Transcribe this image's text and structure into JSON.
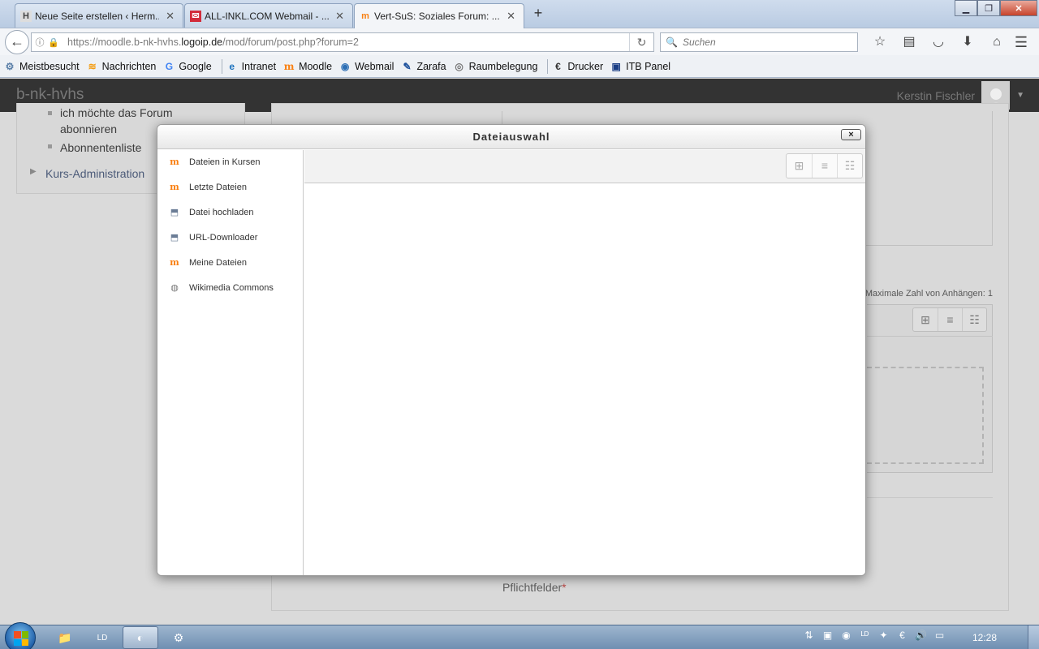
{
  "browser": {
    "tabs": [
      {
        "title": "Neue Seite erstellen ‹ Herm...",
        "icon": "hermes-icon",
        "glyph": "H",
        "color": "#444444"
      },
      {
        "title": "ALL-INKL.COM Webmail - ...",
        "icon": "allinkl-icon",
        "glyph": "✉",
        "color": "#d22c3b"
      },
      {
        "title": "Vert-SuS: Soziales Forum: ...",
        "icon": "moodle-icon",
        "glyph": "m",
        "color": "#f98012"
      }
    ],
    "url_prefix": "https://moodle.b-nk-hvhs.",
    "url_domain": "logoip.de",
    "url_path": "/mod/forum/post.php?forum=2",
    "search_placeholder": "Suchen",
    "bookmarks": [
      {
        "label": "Meistbesucht",
        "glyph": "⚙",
        "color": "#5a7fa8"
      },
      {
        "label": "Nachrichten",
        "glyph": "≋",
        "color": "#f39c12"
      },
      {
        "label": "Google",
        "glyph": "G",
        "color": "#4285f4"
      },
      {
        "label": "Intranet",
        "glyph": "e",
        "color": "#1e73be"
      },
      {
        "label": "Moodle",
        "glyph": "m",
        "color": "#f98012"
      },
      {
        "label": "Webmail",
        "glyph": "◉",
        "color": "#2d6fb5"
      },
      {
        "label": "Zarafa",
        "glyph": "✎",
        "color": "#1b4f9b"
      },
      {
        "label": "Raumbelegung",
        "glyph": "◎",
        "color": "#777777"
      },
      {
        "label": "Drucker",
        "glyph": "€",
        "color": "#333333"
      },
      {
        "label": "ITB Panel",
        "glyph": "▣",
        "color": "#1b3f86"
      }
    ]
  },
  "moodle": {
    "site_name": "b-nk-hvhs",
    "user_name": "Kerstin Fischler",
    "left_block": {
      "item_cut": "ich möchte das Forum",
      "item_cut2": "abonnieren",
      "item2": "Abonnentenliste",
      "course_admin": "Kurs-Administration"
    },
    "max_attachments": "Maximale Zahl von Anhängen: 1",
    "required_label": "Pflichtfelder",
    "required_star": "*"
  },
  "modal": {
    "title": "Dateiauswahl",
    "close_label": "×",
    "repositories": [
      {
        "label": "Dateien in Kursen",
        "icon": "moodle-icon"
      },
      {
        "label": "Letzte Dateien",
        "icon": "moodle-icon"
      },
      {
        "label": "Datei hochladen",
        "icon": "upload-icon"
      },
      {
        "label": "URL-Downloader",
        "icon": "upload-icon"
      },
      {
        "label": "Meine Dateien",
        "icon": "moodle-icon"
      },
      {
        "label": "Wikimedia Commons",
        "icon": "wikimedia-icon"
      }
    ]
  },
  "taskbar": {
    "clock": "12:28"
  }
}
